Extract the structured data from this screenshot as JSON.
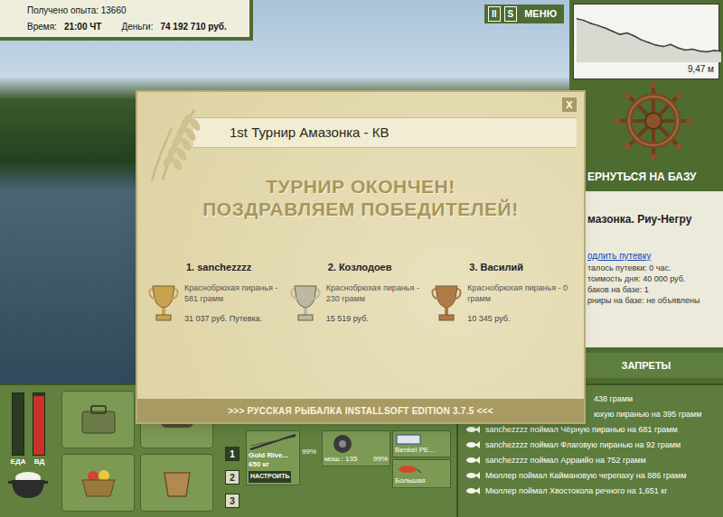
{
  "hud": {
    "experience": "Получено опыта: 13660",
    "time_label": "Время:",
    "time": "21:00 ЧТ",
    "money_label": "Деньги:",
    "money": "74 192 710 руб."
  },
  "top_buttons": [
    "II",
    "S",
    "МЕНЮ"
  ],
  "depth": {
    "reading": "9,47 м",
    "profile": [
      2.0,
      2.4,
      3.1,
      3.6,
      4.2,
      4.9,
      5.6,
      5.3,
      6.0,
      6.9,
      7.5,
      8.1,
      8.4,
      7.9,
      8.7,
      9.2,
      9.0,
      9.4,
      9.6,
      9.3,
      9.47
    ]
  },
  "right_panel": {
    "return_button": "ЕРНУТЬСЯ НА БАЗУ",
    "location": "мазонка. Риу-Негру",
    "extend_link": "одлить путевку",
    "info": [
      "талось путевки: 0 час.",
      "тоимость дня: 40 000 руб.",
      "баков на базе: 1",
      "рниры на базе: не объявлены"
    ],
    "bans_button": "ЗАПРЕТЫ"
  },
  "catch_log": [
    {
      "text": "438 грамм",
      "kind": "cut"
    },
    {
      "text": "юхую пиранью на 395 грамм",
      "kind": "cut"
    },
    {
      "text": "sanchezzzz поймал Чёрную пиранью на 681 грамм",
      "kind": "full"
    },
    {
      "text": "sanchezzzz поймал Флаговую пиранью на 92 грамм",
      "kind": "full"
    },
    {
      "text": "sanchezzzz поймал Арраийо на 752 грамм",
      "kind": "full"
    },
    {
      "text": "Мюллер поймал Каймановую черепаху на 886 грамм",
      "kind": "full"
    },
    {
      "text": "Мюллер поймал Хвостокола речного на 1,651 кг",
      "kind": "full"
    }
  ],
  "status_bars": [
    {
      "label": "ЕДА",
      "level": 0.0,
      "color": "#3a4a30"
    },
    {
      "label": "ВД",
      "level": 0.95,
      "color": "#c8322a"
    }
  ],
  "tackle": {
    "slot_buttons": [
      {
        "label": "1",
        "selected": true
      },
      {
        "label": "2",
        "selected": false
      },
      {
        "label": "3",
        "selected": false
      }
    ],
    "rod": {
      "name": "Gold Rive...",
      "load": "650 кг",
      "button": "НАСТРОИТЬ",
      "wear": "99%"
    },
    "reel": {
      "power": "мош.: 135",
      "wear": "99%"
    },
    "line": {
      "name": "Benkei PE..."
    },
    "lure": {
      "name": "Большая"
    }
  },
  "dialog": {
    "title": "1st Турнир Амазонка - КВ",
    "close": "X",
    "headline": [
      "ТУРНИР ОКОНЧЕН!",
      "ПОЗДРАВЛЯЕМ ПОБЕДИТЕЛЕЙ!"
    ],
    "winners": [
      {
        "place": "1. sanchezzzz",
        "catch": "Краснобрюхая пиранья - 581 грамм",
        "prize": "31 037 руб. Путевка.",
        "color": "#c9a24e"
      },
      {
        "place": "2. Козлодоев",
        "catch": "Краснобрюхая пиранья - 230 грамм",
        "prize": "15 519 руб.",
        "color": "#bdb8a4"
      },
      {
        "place": "3. Василий",
        "catch": "Краснобрюхая пиранья - 0 грамм",
        "prize": "10 345 руб.",
        "color": "#b07a45"
      }
    ],
    "footer": ">>> РУССКАЯ РЫБАЛКА INSTALLSOFT EDITION 3.7.5 <<<"
  }
}
